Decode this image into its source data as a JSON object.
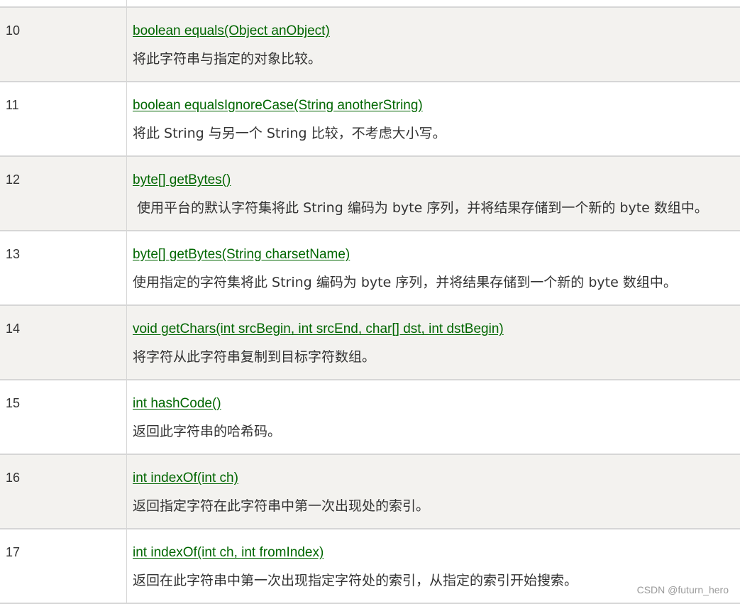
{
  "rows": [
    {
      "index": "10",
      "method": "boolean equals(Object anObject)",
      "description": "将此字符串与指定的对象比较。"
    },
    {
      "index": "11",
      "method": "boolean equalsIgnoreCase(String anotherString)",
      "description": "将此 String 与另一个 String 比较，不考虑大小写。"
    },
    {
      "index": "12",
      "method": "byte[] getBytes()",
      "description": " 使用平台的默认字符集将此 String 编码为 byte 序列，并将结果存储到一个新的 byte 数组中。"
    },
    {
      "index": "13",
      "method": "byte[] getBytes(String charsetName)",
      "description": "使用指定的字符集将此 String 编码为 byte 序列，并将结果存储到一个新的 byte 数组中。"
    },
    {
      "index": "14",
      "method": "void getChars(int srcBegin, int srcEnd, char[] dst, int dstBegin)",
      "description": "将字符从此字符串复制到目标字符数组。"
    },
    {
      "index": "15",
      "method": "int hashCode()",
      "description": "返回此字符串的哈希码。"
    },
    {
      "index": "16",
      "method": "int indexOf(int ch)",
      "description": "返回指定字符在此字符串中第一次出现处的索引。"
    },
    {
      "index": "17",
      "method": "int indexOf(int ch, int fromIndex)",
      "description": "返回在此字符串中第一次出现指定字符处的索引，从指定的索引开始搜索。"
    }
  ],
  "watermark": "CSDN @futurn_hero",
  "colors": {
    "link": "#006600",
    "row_shade": "#f3f2ef",
    "border": "#d6d6d6",
    "text": "#333333"
  }
}
